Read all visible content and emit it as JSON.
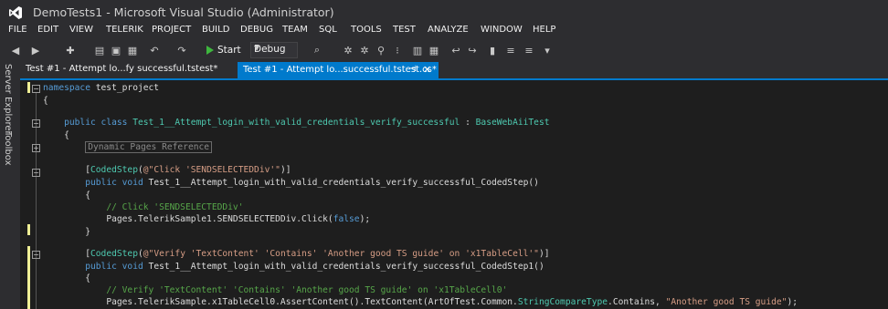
{
  "window": {
    "title": "DemoTests1 - Microsoft Visual Studio (Administrator)"
  },
  "menu": [
    "FILE",
    "EDIT",
    "VIEW",
    "TELERIK",
    "PROJECT",
    "BUILD",
    "DEBUG",
    "TEAM",
    "SQL",
    "TOOLS",
    "TEST",
    "ANALYZE",
    "WINDOW",
    "HELP"
  ],
  "toolbar": {
    "start_label": "Start",
    "config_value": "Debug"
  },
  "side_panels": [
    "Server Explorer",
    "Toolbox"
  ],
  "tabs": [
    {
      "label": "Test #1 - Attempt lo...fy successful.tstest*",
      "active": false
    },
    {
      "label": "Test #1 - Attempt lo...successful.tstest.cs*",
      "active": true
    }
  ],
  "code": {
    "ns_kw": "namespace",
    "ns_name": " test_project",
    "open1": "{",
    "class_mods": "public class",
    "class_name": " Test_1__Attempt_login_with_valid_credentials_verify_successful",
    "class_sep": " : ",
    "class_base": "BaseWebAiiTest",
    "open2": "{",
    "region_label": "Dynamic Pages Reference",
    "attr1_open": "[",
    "attr1_name": "CodedStep",
    "attr1_paren": "(",
    "attr1_str": "@\"Click 'SENDSELECTEDDiv'\"",
    "attr1_close": ")]",
    "m1_kw": "public void",
    "m1_name": " Test_1__Attempt_login_with_valid_credentials_verify_successful_CodedStep()",
    "m1_open": "{",
    "m1_comment": "// Click 'SENDSELECTEDDiv'",
    "m1_stmt_a": "Pages.TelerikSample1.SENDSELECTEDDiv.Click(",
    "m1_stmt_false": "false",
    "m1_stmt_b": ");",
    "m1_close": "}",
    "attr2_open": "[",
    "attr2_name": "CodedStep",
    "attr2_paren": "(",
    "attr2_str": "@\"Verify 'TextContent' 'Contains' 'Another good TS guide' on 'x1TableCell'\"",
    "attr2_close": ")]",
    "m2_kw": "public void",
    "m2_name": " Test_1__Attempt_login_with_valid_credentials_verify_successful_CodedStep1()",
    "m2_open": "{",
    "m2_comment": "// Verify 'TextContent' 'Contains' 'Another good TS guide' on 'x1TableCell0'",
    "m2_stmt_a": "Pages.TelerikSample.x1TableCell0.AssertContent().TextContent(ArtOfTest.Common.",
    "m2_stmt_type": "StringCompareType",
    "m2_stmt_b": ".Contains, ",
    "m2_stmt_str": "\"Another good TS guide\"",
    "m2_stmt_c": ");"
  }
}
